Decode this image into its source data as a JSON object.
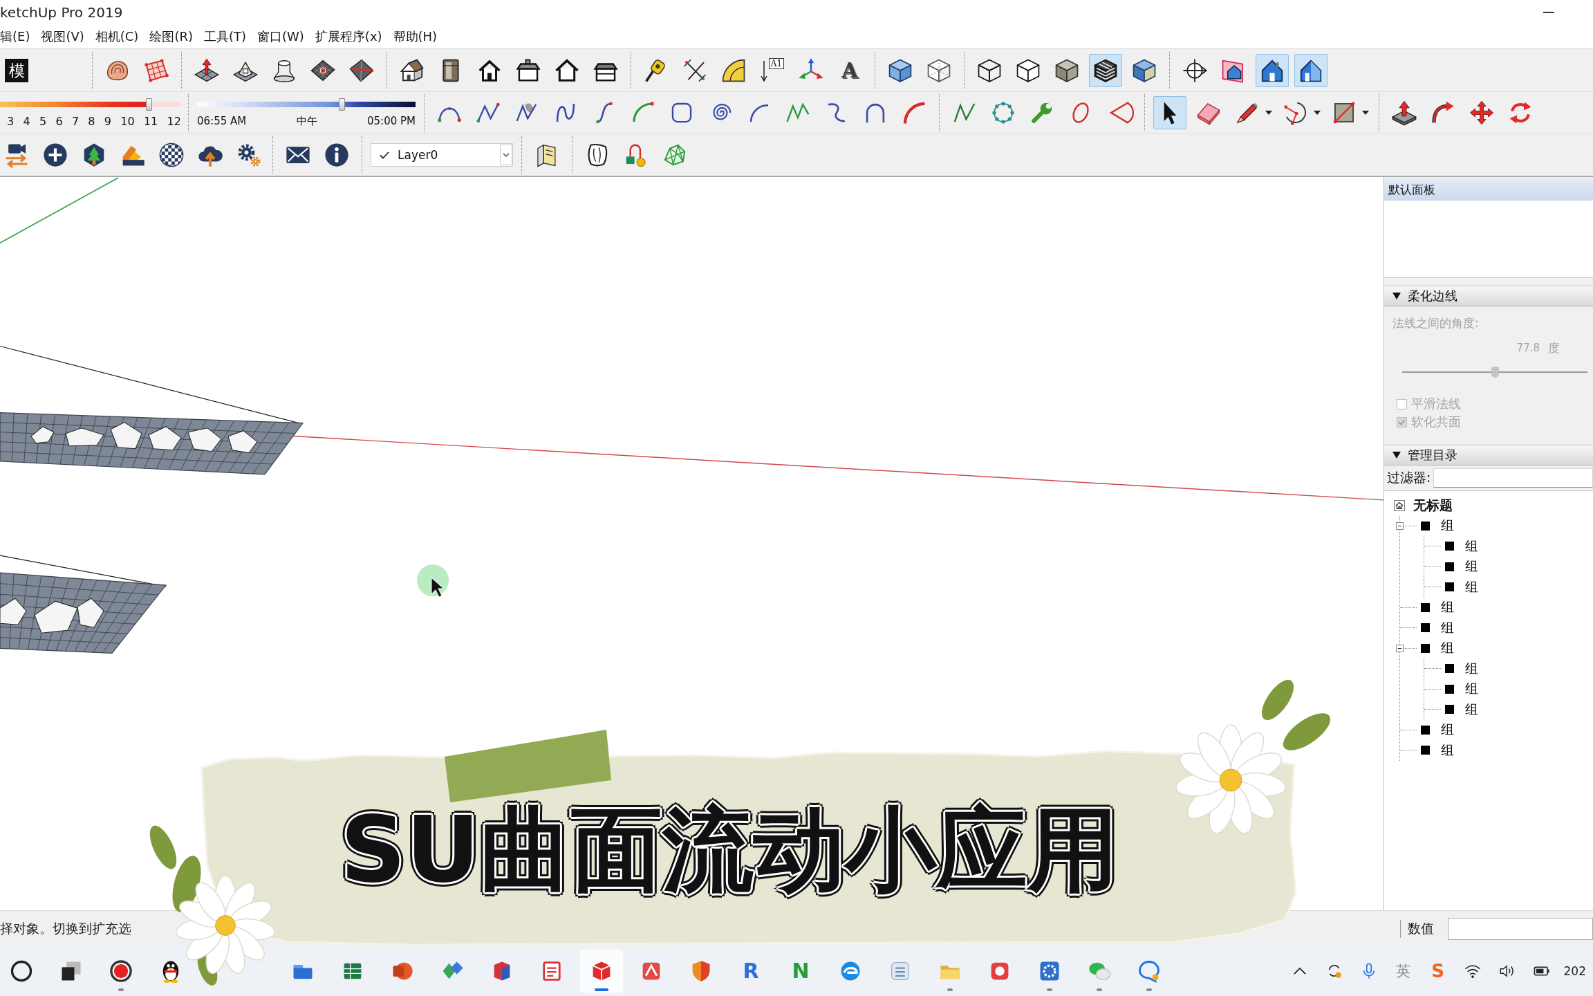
{
  "window": {
    "title": "ketchUp Pro 2019"
  },
  "menu": [
    "辑(E)",
    "视图(V)",
    "相机(C)",
    "绘图(R)",
    "工具(T)",
    "窗口(W)",
    "扩展程序(x)",
    "帮助(H)"
  ],
  "toolbar_rows": [
    {
      "groups": [
        {
          "kind": "buttons",
          "buttons": [
            {
              "kind": "glyph-badge",
              "glyph": "模",
              "selected": false
            }
          ]
        },
        {
          "kind": "buttons",
          "buttons": [
            {
              "kind": "contour-terrain",
              "selected": false
            },
            {
              "kind": "grid-terrain",
              "selected": false
            }
          ]
        },
        {
          "kind": "buttons",
          "buttons": [
            {
              "kind": "smoove-terrain",
              "selected": false
            },
            {
              "kind": "stamp-terrain",
              "selected": false
            },
            {
              "kind": "drape-terrain",
              "selected": false
            },
            {
              "kind": "detail-terrain",
              "selected": false
            },
            {
              "kind": "flip-edge-terrain",
              "selected": false
            }
          ]
        },
        {
          "kind": "buttons",
          "buttons": [
            {
              "kind": "iso-house",
              "selected": false
            },
            {
              "kind": "top-view-box",
              "selected": false
            },
            {
              "kind": "front-house",
              "selected": false
            },
            {
              "kind": "right-house",
              "selected": false
            },
            {
              "kind": "back-house",
              "selected": false
            },
            {
              "kind": "left-house",
              "selected": false
            }
          ]
        },
        {
          "kind": "buttons",
          "buttons": [
            {
              "kind": "tape-measure",
              "selected": false
            },
            {
              "kind": "dimension",
              "selected": false
            },
            {
              "kind": "protractor",
              "selected": false
            },
            {
              "kind": "text-label",
              "glyph": "A1",
              "selected": false
            },
            {
              "kind": "axes",
              "selected": false
            },
            {
              "kind": "text-3d",
              "glyph": "A",
              "selected": false
            }
          ]
        },
        {
          "kind": "buttons",
          "buttons": [
            {
              "kind": "xray-cube",
              "selected": false
            },
            {
              "kind": "back-edges-cube",
              "selected": false
            }
          ]
        },
        {
          "kind": "buttons",
          "buttons": [
            {
              "kind": "wireframe-cube",
              "selected": false
            },
            {
              "kind": "hidden-line-cube",
              "selected": false
            },
            {
              "kind": "shaded-cube",
              "selected": false
            },
            {
              "kind": "textured-cube",
              "selected": true
            },
            {
              "kind": "monochrome-cube",
              "selected": false
            }
          ]
        },
        {
          "kind": "buttons",
          "buttons": [
            {
              "kind": "section-plane",
              "selected": false
            },
            {
              "kind": "section-cut-house",
              "selected": false
            },
            {
              "kind": "section-house",
              "selected": true
            },
            {
              "kind": "section-fill-house",
              "selected": true
            }
          ]
        }
      ]
    },
    {
      "groups": [
        {
          "kind": "month-slider",
          "ticks": [
            "3",
            "4",
            "5",
            "6",
            "7",
            "8",
            "9",
            "10",
            "11",
            "12"
          ],
          "level": 0.82
        },
        {
          "kind": "time-slider",
          "start": "06:55 AM",
          "middle": "中午",
          "end": "05:00 PM",
          "level": 0.66
        },
        {
          "kind": "buttons",
          "buttons": [
            {
              "kind": "bezier",
              "selected": false
            },
            {
              "kind": "polyline",
              "selected": false
            },
            {
              "kind": "freehand",
              "selected": false
            },
            {
              "kind": "n-curve",
              "selected": false
            },
            {
              "kind": "s-curve",
              "selected": false
            },
            {
              "kind": "quarter-arc",
              "selected": false
            },
            {
              "kind": "rounded-square",
              "selected": false
            },
            {
              "kind": "spiral",
              "selected": false
            },
            {
              "kind": "open-arc",
              "selected": false
            },
            {
              "kind": "zigzag",
              "selected": false
            },
            {
              "kind": "hook",
              "selected": false
            },
            {
              "kind": "arch",
              "selected": false
            },
            {
              "kind": "thick-arc",
              "selected": false
            }
          ]
        },
        {
          "kind": "buttons",
          "buttons": [
            {
              "kind": "polyline-edit",
              "selected": false
            },
            {
              "kind": "polygon-ring",
              "selected": false
            },
            {
              "kind": "wrench",
              "selected": false
            },
            {
              "kind": "loop",
              "selected": false
            },
            {
              "kind": "sector",
              "selected": false
            }
          ]
        },
        {
          "kind": "buttons",
          "buttons": [
            {
              "kind": "select",
              "selected": true,
              "dropdown": false
            },
            {
              "kind": "eraser",
              "selected": false,
              "dropdown": false
            },
            {
              "kind": "pencil",
              "selected": false,
              "dropdown": true
            },
            {
              "kind": "arc-tool",
              "selected": false,
              "dropdown": true
            },
            {
              "kind": "rectangle-tool",
              "selected": false,
              "dropdown": true
            }
          ]
        },
        {
          "kind": "buttons",
          "buttons": [
            {
              "kind": "push-pull",
              "selected": false
            },
            {
              "kind": "follow-me",
              "selected": false
            },
            {
              "kind": "move",
              "selected": false
            },
            {
              "kind": "rotate",
              "selected": false
            }
          ]
        }
      ]
    },
    {
      "groups": [
        {
          "kind": "buttons",
          "buttons": [
            {
              "kind": "camera-swap",
              "selected": false
            },
            {
              "kind": "plus-circle",
              "selected": false
            },
            {
              "kind": "tree-badge",
              "selected": false
            },
            {
              "kind": "swatches",
              "selected": false
            },
            {
              "kind": "checker-sphere",
              "selected": false
            },
            {
              "kind": "cloud-upload",
              "selected": false
            },
            {
              "kind": "gears",
              "selected": false
            }
          ]
        },
        {
          "kind": "buttons",
          "buttons": [
            {
              "kind": "envelope",
              "selected": false
            },
            {
              "kind": "info",
              "selected": false
            }
          ]
        },
        {
          "kind": "layer-select",
          "visible": true,
          "value": "Layer0"
        },
        {
          "kind": "buttons",
          "buttons": [
            {
              "kind": "warehouse",
              "selected": false
            }
          ]
        },
        {
          "kind": "buttons",
          "buttons": [
            {
              "kind": "shield-shape",
              "selected": false
            },
            {
              "kind": "tag-bulb",
              "selected": false
            },
            {
              "kind": "mesh",
              "selected": false
            }
          ]
        }
      ]
    }
  ],
  "tray": {
    "title": "默认面板",
    "panels": [
      {
        "kind": "soften",
        "title": "柔化边线",
        "expanded": true,
        "disabled": true,
        "label": "法线之间的角度:",
        "value": "77.8",
        "unit": "度",
        "level": 0.5,
        "options": [
          {
            "label": "平滑法线",
            "checked": false
          },
          {
            "label": "软化共面",
            "checked": true
          }
        ]
      },
      {
        "kind": "outliner",
        "title": "管理目录",
        "expanded": true,
        "disabled": false,
        "filter_label": "过滤器:",
        "root": {
          "label": "无标题",
          "children": [
            {
              "label": "组",
              "expanded": true,
              "children": [
                {
                  "label": "组"
                },
                {
                  "label": "组"
                },
                {
                  "label": "组"
                }
              ]
            },
            {
              "label": "组"
            },
            {
              "label": "组"
            },
            {
              "label": "组",
              "expanded": true,
              "children": [
                {
                  "label": "组"
                },
                {
                  "label": "组"
                },
                {
                  "label": "组"
                }
              ]
            },
            {
              "label": "组"
            },
            {
              "label": "组"
            }
          ]
        }
      }
    ]
  },
  "status_bar": {
    "hint": "择对象。切换到扩充选",
    "measurement_label": "数值"
  },
  "overlay": {
    "caption": "SU曲面流动小应用"
  },
  "taskbar": {
    "apps": [
      {
        "kind": "search",
        "selected": false,
        "running": false
      },
      {
        "kind": "task-view",
        "selected": false,
        "running": false
      },
      {
        "kind": "record",
        "selected": false,
        "running": true
      },
      {
        "kind": "penguin",
        "selected": false,
        "running": false
      },
      {
        "kind": "file-manager",
        "selected": false,
        "running": false
      },
      {
        "kind": "spreadsheet",
        "selected": false,
        "running": false
      },
      {
        "kind": "presentation",
        "selected": false,
        "running": false
      },
      {
        "kind": "gem",
        "selected": false,
        "running": false
      },
      {
        "kind": "cube-app",
        "selected": false,
        "running": false
      },
      {
        "kind": "document",
        "selected": false,
        "running": false
      },
      {
        "kind": "box-logo",
        "selected": true,
        "running": true
      },
      {
        "kind": "pdf",
        "selected": false,
        "running": false
      },
      {
        "kind": "shield",
        "selected": false,
        "running": false
      },
      {
        "kind": "letter",
        "glyph": "R",
        "color": "#2f6fd6",
        "selected": false,
        "running": false
      },
      {
        "kind": "letter",
        "glyph": "N",
        "color": "#2a9a3a",
        "selected": false,
        "running": false
      },
      {
        "kind": "browser",
        "selected": false,
        "running": false
      },
      {
        "kind": "tile",
        "selected": false,
        "running": false
      },
      {
        "kind": "folder",
        "selected": false,
        "running": true
      },
      {
        "kind": "app-square",
        "selected": false,
        "running": false
      },
      {
        "kind": "gear-app",
        "selected": false,
        "running": true
      },
      {
        "kind": "chat-bubbles",
        "selected": false,
        "running": true
      },
      {
        "kind": "chat-bubble",
        "selected": false,
        "running": true
      }
    ],
    "tray": [
      {
        "kind": "chevron"
      },
      {
        "kind": "sync"
      },
      {
        "kind": "microphone"
      },
      {
        "kind": "ime",
        "glyph": "英"
      },
      {
        "kind": "input-method",
        "glyph": "S"
      },
      {
        "kind": "wifi"
      },
      {
        "kind": "volume"
      },
      {
        "kind": "battery"
      }
    ],
    "clock": "202"
  }
}
